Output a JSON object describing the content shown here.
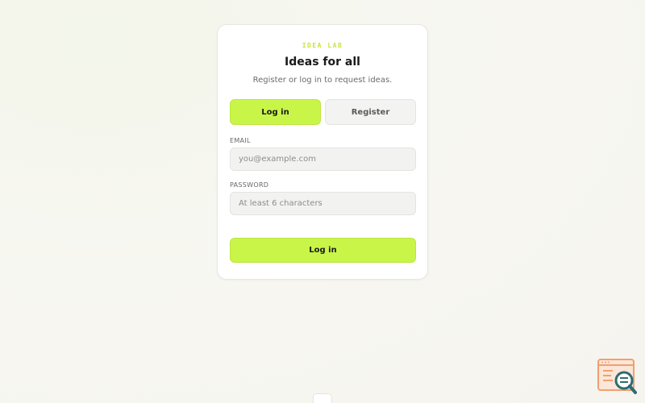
{
  "card": {
    "brand": "IDEA LAB",
    "title": "Ideas for all",
    "subtitle": "Register or log in to request ideas."
  },
  "tabs": [
    {
      "label": "Log in",
      "active": true
    },
    {
      "label": "Register",
      "active": false
    }
  ],
  "form": {
    "email_label": "EMAIL",
    "email_placeholder": "you@example.com",
    "email_value": "",
    "password_label": "PASSWORD",
    "password_placeholder": "At least 6 characters",
    "password_value": "",
    "submit_label": "Log in"
  },
  "widget": {
    "icon": "search-browser-icon"
  },
  "colors": {
    "accent": "#c9f549",
    "brand_text": "#c6e63a",
    "widget_orange": "#f0a070",
    "widget_teal": "#2f6b73"
  }
}
